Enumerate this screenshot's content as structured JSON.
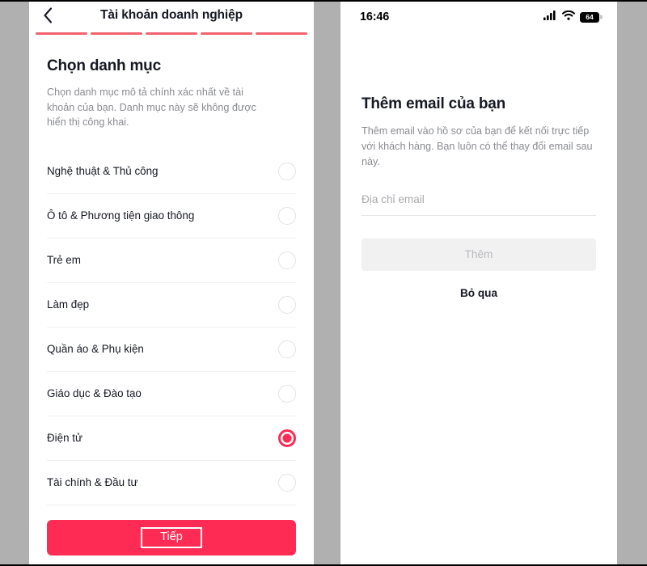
{
  "theme": {
    "accent": "#fe2c55",
    "progress_segment": "#f2626e",
    "text_primary": "#161823",
    "text_secondary": "#8a8b91",
    "bezel_gray": "#b0b0b0",
    "disabled_bg": "#f1f1f2",
    "disabled_text": "#b8b9bd"
  },
  "left_screen": {
    "nav": {
      "back_icon": "chevron-left-icon",
      "title": "Tài khoản doanh nghiệp"
    },
    "progress": {
      "total_segments": 5,
      "completed_segments": 5
    },
    "heading": "Chọn danh mục",
    "description": "Chọn danh mục mô tả chính xác nhất về tài khoản của bạn. Danh mục này sẽ không được hiển thị công khai.",
    "categories": [
      {
        "label": "Nghệ thuật & Thủ công",
        "selected": false
      },
      {
        "label": "Ô tô & Phương tiện giao thông",
        "selected": false
      },
      {
        "label": "Trẻ em",
        "selected": false
      },
      {
        "label": "Làm đẹp",
        "selected": false
      },
      {
        "label": "Quần áo & Phụ kiện",
        "selected": false
      },
      {
        "label": "Giáo dục & Đào tạo",
        "selected": false
      },
      {
        "label": "Điện tử",
        "selected": true
      },
      {
        "label": "Tài chính & Đầu tư",
        "selected": false
      }
    ],
    "primary_button": "Tiếp"
  },
  "right_screen": {
    "status_bar": {
      "time": "16:46",
      "signal_icon": "cellular-signal-icon",
      "wifi_icon": "wifi-icon",
      "battery_icon": "battery-icon",
      "battery_level": "64"
    },
    "heading": "Thêm email của bạn",
    "description": "Thêm email vào hồ sơ của bạn để kết nối trực tiếp với khách hàng. Bạn luôn có thể thay đổi email sau này.",
    "email_field": {
      "placeholder": "Địa chỉ email",
      "value": ""
    },
    "add_button": "Thêm",
    "skip_button": "Bỏ qua"
  }
}
